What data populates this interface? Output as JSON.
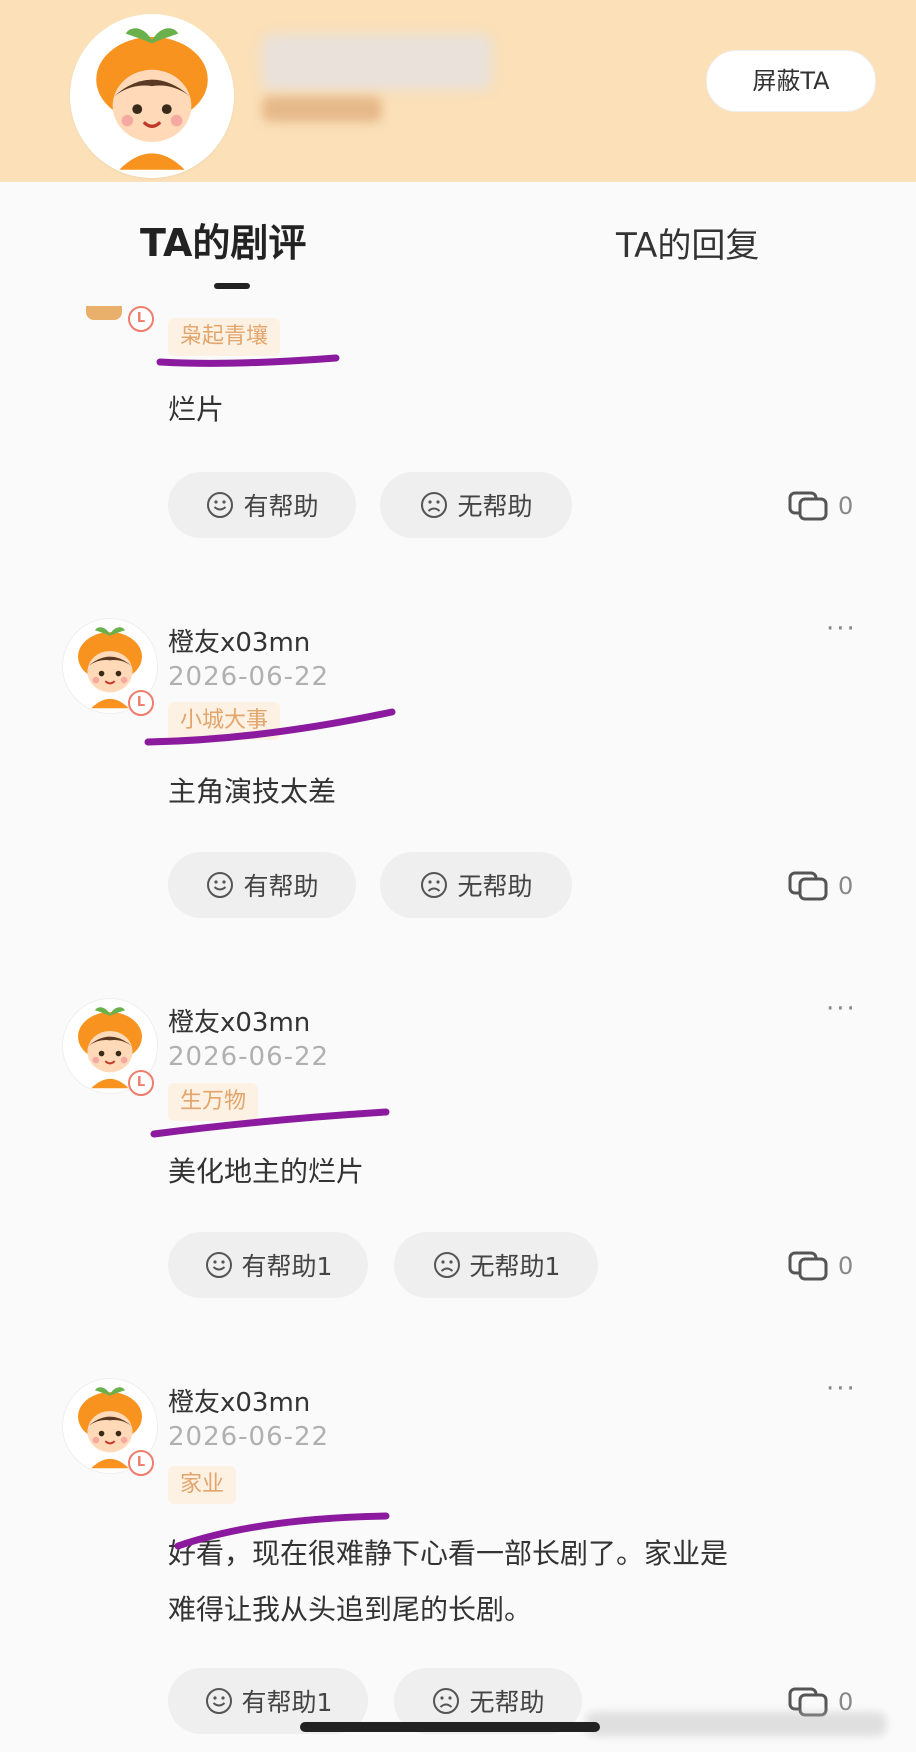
{
  "header": {
    "block_label": "屏蔽TA"
  },
  "tabs": [
    {
      "label": "TA的剧评",
      "active": true
    },
    {
      "label": "TA的回复",
      "active": false
    }
  ],
  "colors": {
    "header_bg": "#fbe0b8",
    "tag_bg": "#fdf1e3",
    "tag_text": "#e2a56b",
    "highlight_stroke": "#8b1a9e"
  },
  "reviews": [
    {
      "tag": "枭起青壤",
      "text": "烂片",
      "helpful": "有帮助",
      "unhelpful": "无帮助",
      "comments": "0"
    },
    {
      "name": "橙友x03mn",
      "date": "2026-06-22",
      "tag": "小城大事",
      "text": "主角演技太差",
      "helpful": "有帮助",
      "unhelpful": "无帮助",
      "comments": "0"
    },
    {
      "name": "橙友x03mn",
      "date": "2026-06-22",
      "tag": "生万物",
      "text": "美化地主的烂片",
      "helpful": "有帮助1",
      "unhelpful": "无帮助1",
      "comments": "0"
    },
    {
      "name": "橙友x03mn",
      "date": "2026-06-22",
      "tag": "家业",
      "text_line1": "好看，现在很难静下心看一部长剧了。家业是",
      "text_line2": "难得让我从头追到尾的长剧。",
      "helpful": "有帮助1",
      "unhelpful": "无帮助",
      "comments": "0"
    }
  ]
}
